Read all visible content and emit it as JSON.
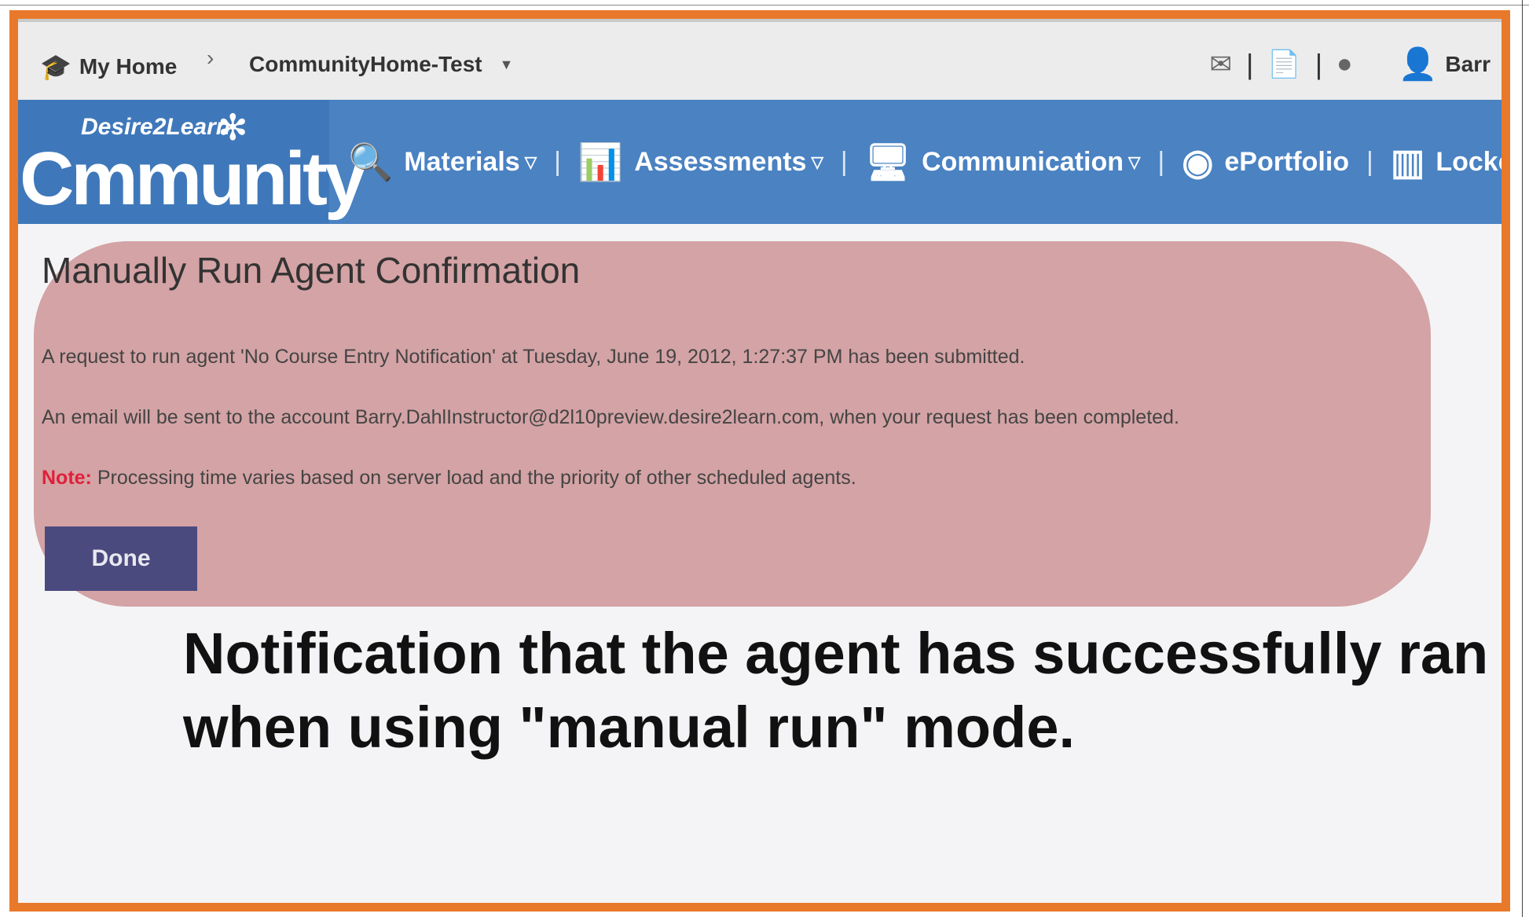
{
  "topbar": {
    "home_label": "My Home",
    "course_label": "CommunityHome-Test",
    "user_label": "Barr"
  },
  "logo": {
    "brand_small": "Desire2Learn",
    "brand_large": "Cmmunity"
  },
  "nav": {
    "items": [
      {
        "label": "Materials"
      },
      {
        "label": "Assessments"
      },
      {
        "label": "Communication"
      },
      {
        "label": "ePortfolio"
      },
      {
        "label": "Locker"
      }
    ]
  },
  "content": {
    "title": "Manually Run Agent Confirmation",
    "message1": "A request to run agent 'No Course Entry Notification' at Tuesday, June 19, 2012, 1:27:37 PM has been submitted.",
    "message2": "An email will be sent to the account Barry.DahlInstructor@d2l10preview.desire2learn.com, when your request has been completed.",
    "note_label": "Note:",
    "note_text": " Processing time varies based on server load and the priority of other scheduled agents.",
    "done_label": "Done"
  },
  "caption": "Notification that the agent has successfully ran when using \"manual run\" mode.",
  "colors": {
    "frame": "#e8792a",
    "navbar": "#4a82c2",
    "highlight": "#d4a3a5",
    "note": "#e0203a",
    "done_button": "#4b4a7e"
  }
}
